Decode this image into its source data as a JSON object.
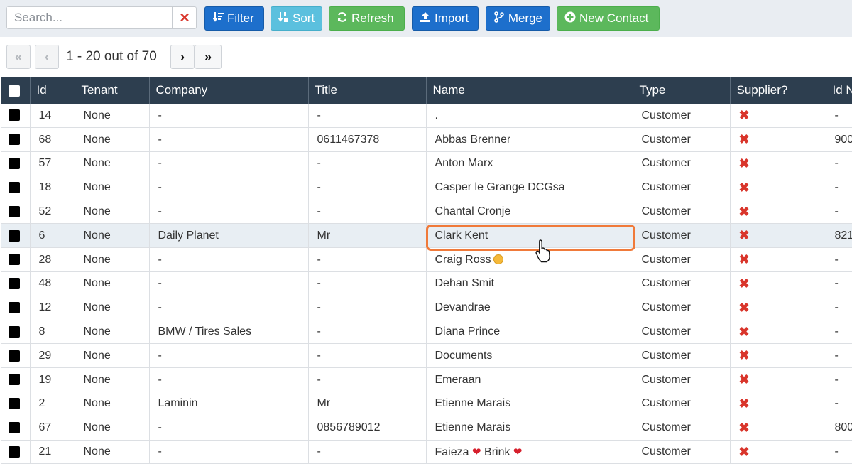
{
  "toolbar": {
    "search_placeholder": "Search...",
    "buttons": {
      "filter": "Filter",
      "sort": "Sort",
      "refresh": "Refresh",
      "import": "Import",
      "merge": "Merge",
      "new_contact": "New Contact"
    }
  },
  "pager": {
    "range_text": "1 - 20 out of 70"
  },
  "table": {
    "columns": [
      "Id",
      "Tenant",
      "Company",
      "Title",
      "Name",
      "Type",
      "Supplier?",
      "Id N"
    ],
    "rows": [
      {
        "id": "14",
        "tenant": "None",
        "company": "-",
        "title": "-",
        "name": ".",
        "type": "Customer",
        "idn": "-"
      },
      {
        "id": "68",
        "tenant": "None",
        "company": "-",
        "title": "0611467378",
        "name": "Abbas Brenner",
        "type": "Customer",
        "idn": "900"
      },
      {
        "id": "57",
        "tenant": "None",
        "company": "-",
        "title": "-",
        "name": "Anton Marx",
        "type": "Customer",
        "idn": "-"
      },
      {
        "id": "18",
        "tenant": "None",
        "company": "-",
        "title": "-",
        "name": "Casper le Grange DCGsa",
        "type": "Customer",
        "idn": "-"
      },
      {
        "id": "52",
        "tenant": "None",
        "company": "-",
        "title": "-",
        "name": "Chantal Cronje",
        "type": "Customer",
        "idn": "-"
      },
      {
        "id": "6",
        "tenant": "None",
        "company": "Daily Planet",
        "title": "Mr",
        "name": "Clark Kent",
        "type": "Customer",
        "idn": "821"
      },
      {
        "id": "28",
        "tenant": "None",
        "company": "-",
        "title": "-",
        "name": "Craig Ross",
        "type": "Customer",
        "idn": "-"
      },
      {
        "id": "48",
        "tenant": "None",
        "company": "-",
        "title": "-",
        "name": "Dehan Smit",
        "type": "Customer",
        "idn": "-"
      },
      {
        "id": "12",
        "tenant": "None",
        "company": "-",
        "title": "-",
        "name": "Devandrae",
        "type": "Customer",
        "idn": "-"
      },
      {
        "id": "8",
        "tenant": "None",
        "company": "BMW / Tires Sales",
        "title": "-",
        "name": "Diana Prince",
        "type": "Customer",
        "idn": "-"
      },
      {
        "id": "29",
        "tenant": "None",
        "company": "-",
        "title": "-",
        "name": "Documents",
        "type": "Customer",
        "idn": "-"
      },
      {
        "id": "19",
        "tenant": "None",
        "company": "-",
        "title": "-",
        "name": "Emeraan",
        "type": "Customer",
        "idn": "-"
      },
      {
        "id": "2",
        "tenant": "None",
        "company": "Laminin",
        "title": "Mr",
        "name": "Etienne Marais",
        "type": "Customer",
        "idn": "-"
      },
      {
        "id": "67",
        "tenant": "None",
        "company": "-",
        "title": "0856789012",
        "name": "Etienne Marais",
        "type": "Customer",
        "idn": "800"
      },
      {
        "id": "21",
        "tenant": "None",
        "company": "-",
        "title": "-",
        "name_part1": "Faieza",
        "name_part2": "Brink",
        "type": "Customer",
        "idn": "-"
      }
    ]
  },
  "colors": {
    "header_bg": "#2d3e4f",
    "filter_blue": "#1d6fcc",
    "sort_lightblue": "#5bc0de",
    "green": "#5cb85c",
    "danger_red": "#d9352b",
    "highlight_orange": "#f07a3a"
  },
  "icons": {
    "filter": "sort-amount-down-icon",
    "sort": "sort-numeric-icon",
    "refresh": "refresh-icon",
    "import": "upload-icon",
    "merge": "merge-branch-icon",
    "new_contact": "plus-circle-icon",
    "supplier_false": "x-icon"
  }
}
